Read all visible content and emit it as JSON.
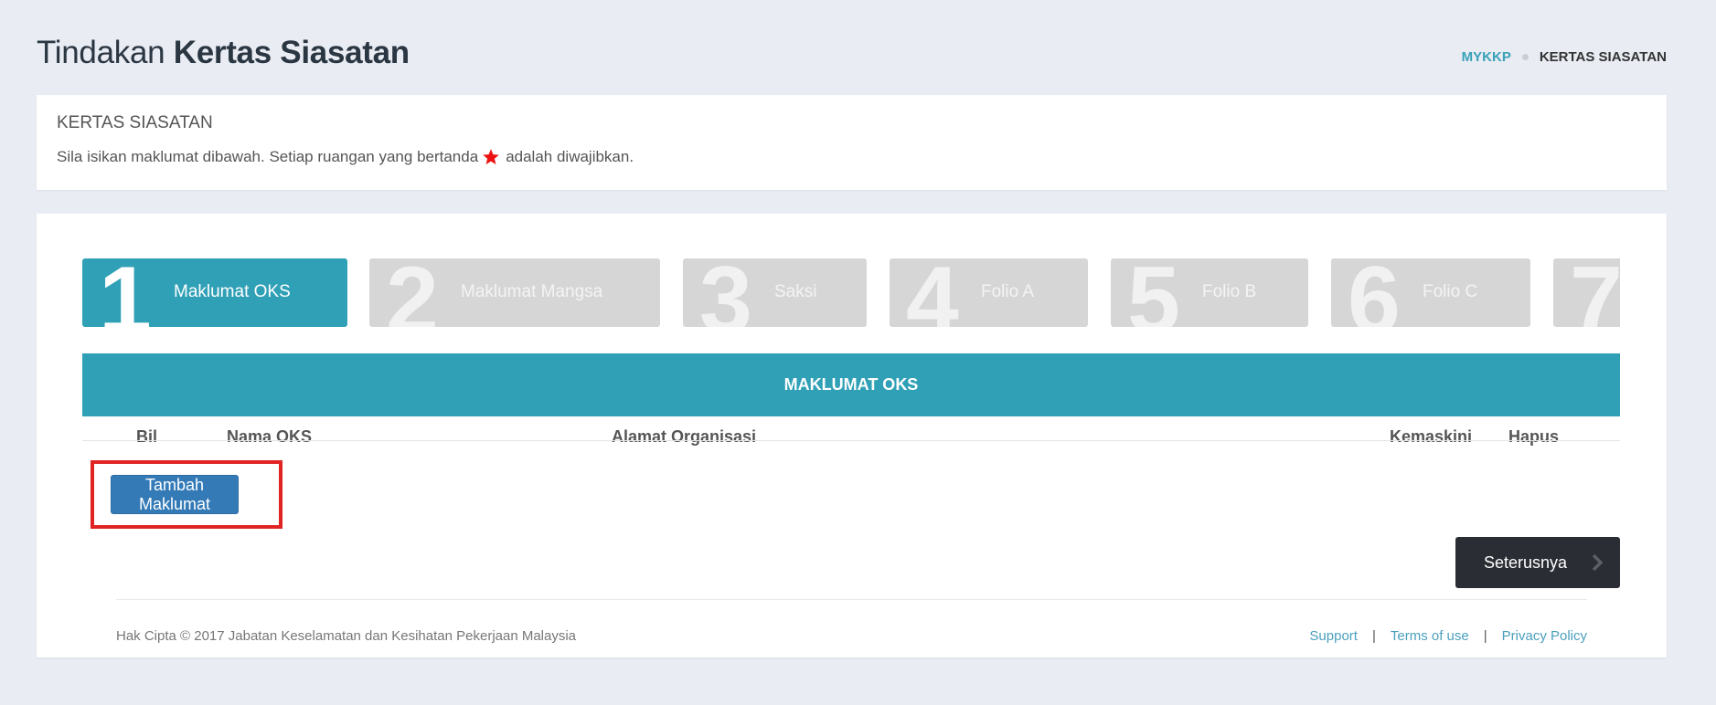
{
  "header": {
    "title_light": "Tindakan",
    "title_bold": "Kertas Siasatan"
  },
  "breadcrumb": {
    "home": "MYKKP",
    "current": "KERTAS SIASATAN"
  },
  "info": {
    "title": "KERTAS SIASATAN",
    "text_before": "Sila isikan maklumat dibawah. Setiap ruangan yang bertanda",
    "text_after": "adalah diwajibkan."
  },
  "steps": [
    {
      "number": "1",
      "label": "Maklumat OKS",
      "active": true
    },
    {
      "number": "2",
      "label": "Maklumat Mangsa",
      "active": false
    },
    {
      "number": "3",
      "label": "Saksi",
      "active": false
    },
    {
      "number": "4",
      "label": "Folio A",
      "active": false
    },
    {
      "number": "5",
      "label": "Folio B",
      "active": false
    },
    {
      "number": "6",
      "label": "Folio C",
      "active": false
    },
    {
      "number": "7",
      "label": "",
      "active": false
    }
  ],
  "table": {
    "title": "MAKLUMAT OKS",
    "columns": [
      "Bil",
      "Nama OKS",
      "Alamat Organisasi",
      "Kemaskini",
      "Hapus"
    ]
  },
  "buttons": {
    "add": "Tambah Maklumat",
    "next": "Seterusnya"
  },
  "footer": {
    "copyright": "Hak Cipta © 2017 Jabatan Keselamatan dan Kesihatan Pekerjaan Malaysia",
    "links": [
      "Support",
      "Terms of use",
      "Privacy Policy"
    ]
  },
  "colors": {
    "accent": "#30a0b6",
    "primary_button": "#337ab7",
    "dark_button": "#2a2d33",
    "highlight": "#e02424",
    "required_star": "#ee1111",
    "step_inactive": "#d6d6d6"
  },
  "icons": {
    "required": "star-icon",
    "next": "chevron-right-icon"
  }
}
